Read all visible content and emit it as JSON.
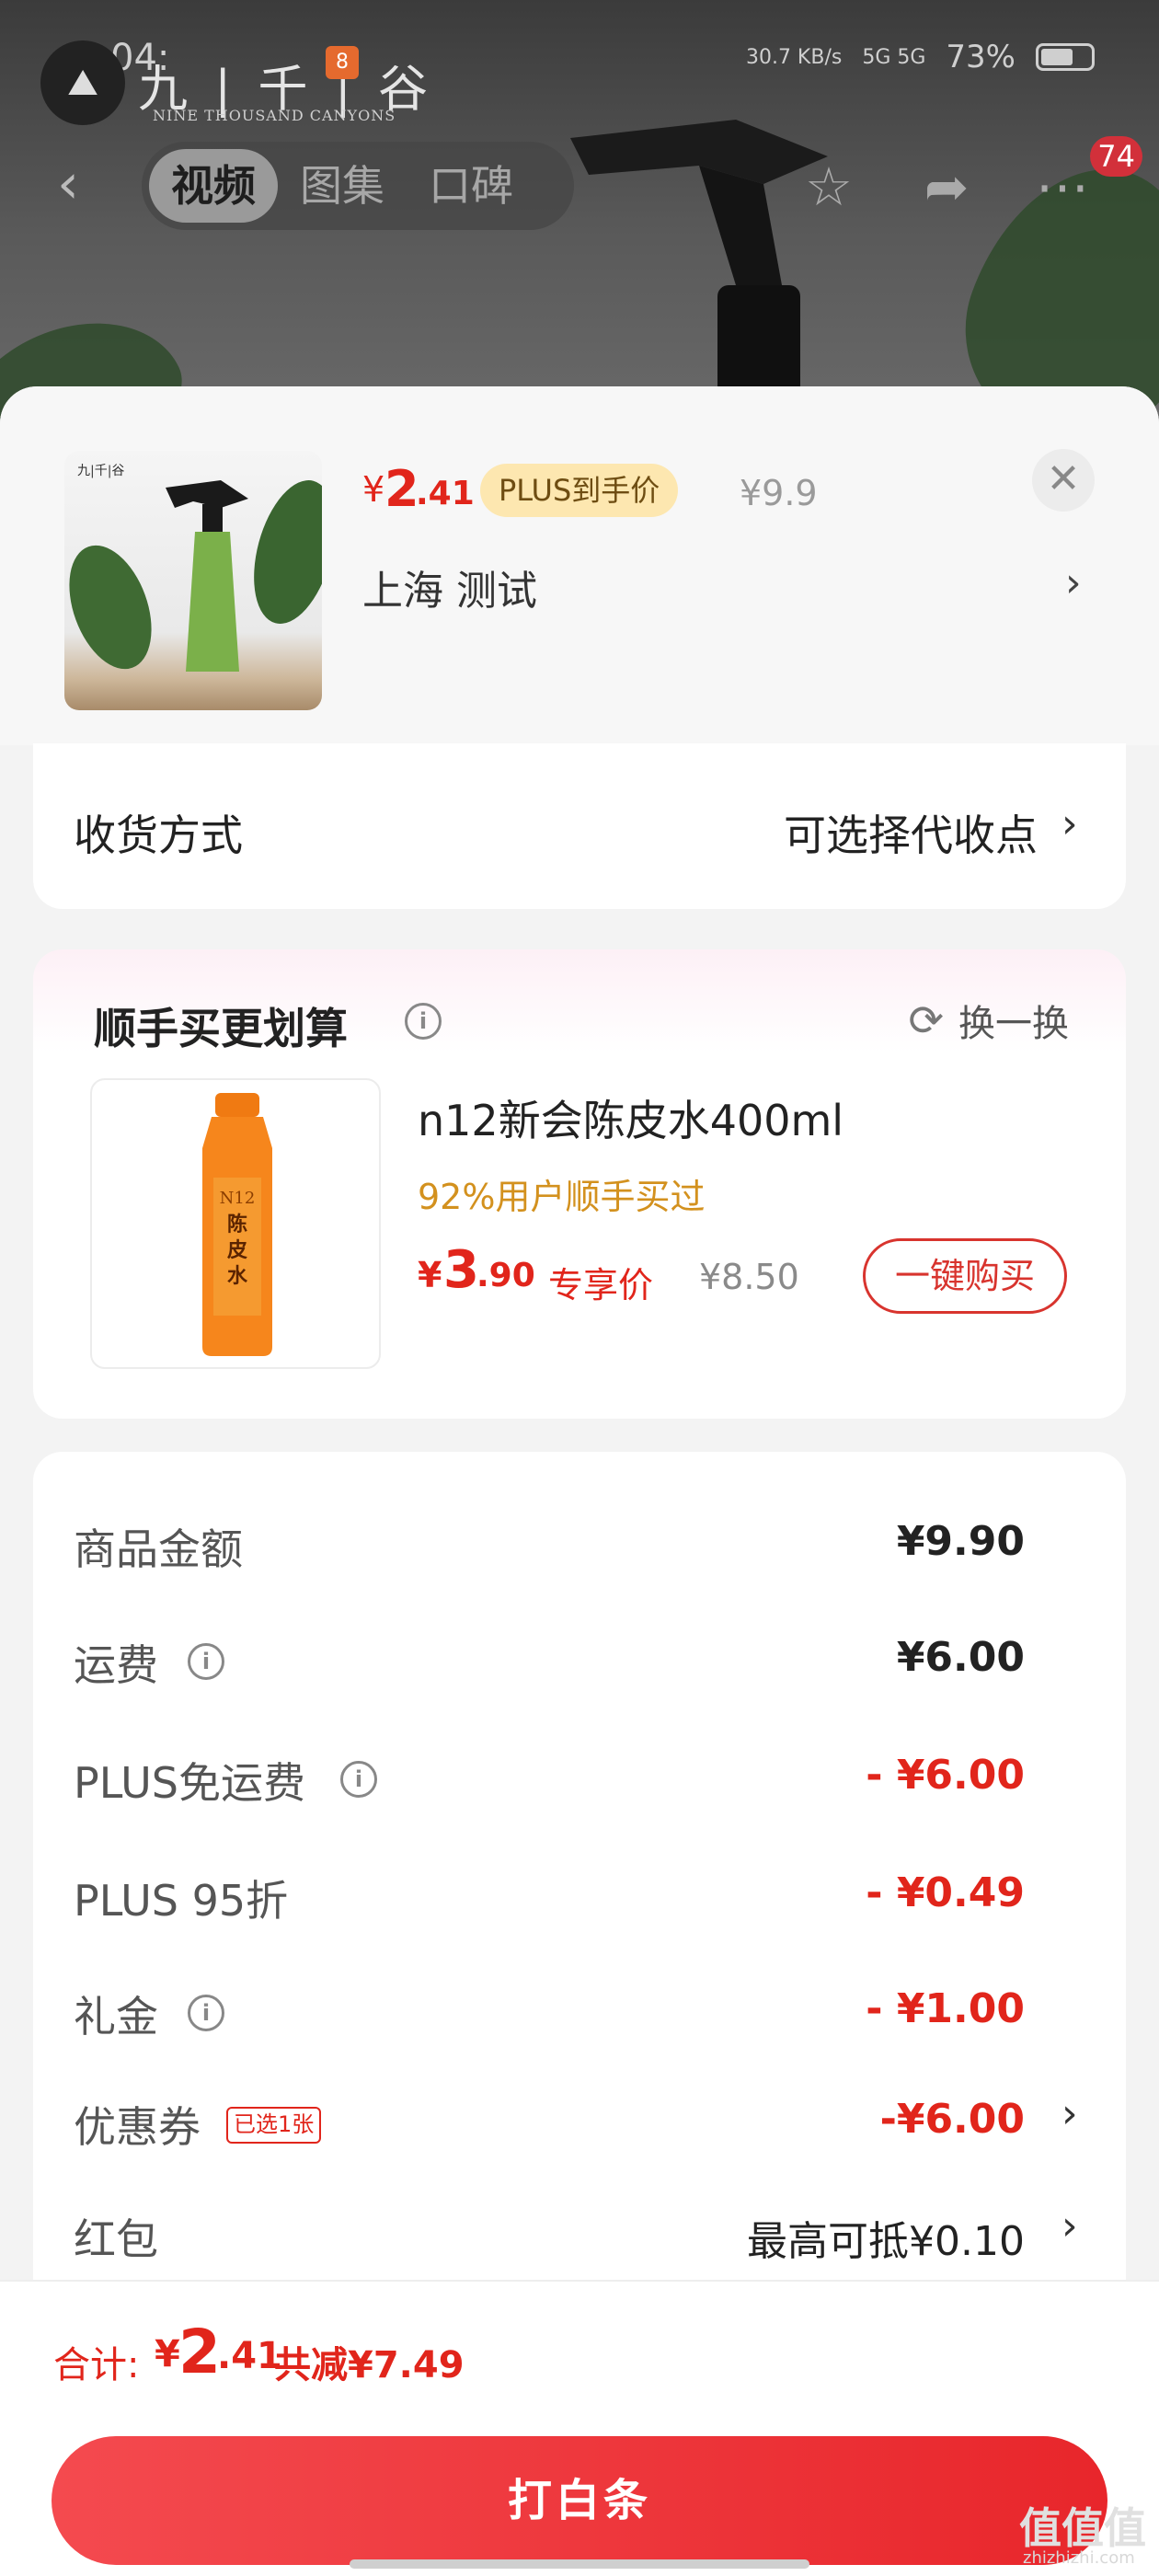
{
  "status_bar": {
    "time": "04:",
    "network_speed": "30.7 KB/s",
    "signal": "5G 5G",
    "battery": "73%"
  },
  "brand": {
    "name": "九 | 千 | 谷",
    "subtitle": "NINE THOUSAND CANYONS",
    "app_badge": "8"
  },
  "nav": {
    "tabs": [
      {
        "label": "视频",
        "active": true
      },
      {
        "label": "图集",
        "active": false
      },
      {
        "label": "口碑",
        "active": false
      }
    ],
    "message_count": "74"
  },
  "product": {
    "price_currency": "¥",
    "price_int": "2",
    "price_dec": ".41",
    "plus_tag": "PLUS到手价",
    "original_price": "¥9.9",
    "address": "上海  测试"
  },
  "shipping": {
    "label": "收货方式",
    "value": "可选择代收点"
  },
  "addon": {
    "title": "顺手买更划算",
    "swap_label": "换一换",
    "item_name": "n12新会陈皮水400ml",
    "item_sub": "92%用户顺手买过",
    "price_currency": "¥",
    "price_int": "3",
    "price_dec": ".90",
    "price_tag": "专享价",
    "original_price": "¥8.50",
    "buy_label": "一键购买",
    "bottle_text": "陈皮水",
    "bottle_brand": "N12"
  },
  "summary": {
    "rows": [
      {
        "label": "商品金额",
        "value": "¥9.90",
        "red": false,
        "info": false
      },
      {
        "label": "运费",
        "value": "¥6.00",
        "red": false,
        "info": true
      },
      {
        "label": "PLUS免运费",
        "value": "- ¥6.00",
        "red": true,
        "info": true
      },
      {
        "label": "PLUS 95折",
        "value": "- ¥0.49",
        "red": true,
        "info": false
      },
      {
        "label": "礼金",
        "value": "- ¥1.00",
        "red": true,
        "info": true
      },
      {
        "label": "优惠券",
        "value": "-¥6.00",
        "red": true,
        "info": false
      },
      {
        "label": "红包",
        "value": "最高可抵¥0.10",
        "red": false,
        "info": false
      }
    ],
    "coupon_tag": "已选1张"
  },
  "total": {
    "label": "合计:",
    "currency": "¥",
    "int": "2",
    "dec": ".41",
    "reduced": "共减¥7.49"
  },
  "pay_button": "打白条",
  "watermark": "值值值",
  "watermark_sub": "zhizhizhi.com",
  "colors": {
    "accent_red": "#e1251b",
    "plus_gold": "#fde7b0",
    "addon_orange": "#d3911e"
  }
}
